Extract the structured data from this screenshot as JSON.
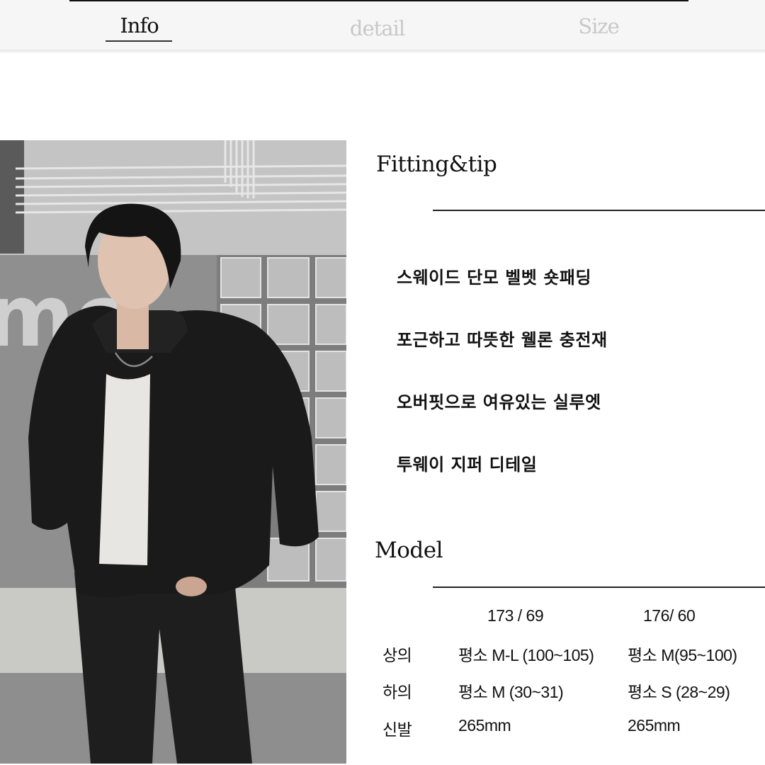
{
  "tabs": [
    {
      "label": "Info",
      "active": true
    },
    {
      "label": "detail",
      "active": false
    },
    {
      "label": "Size",
      "active": false
    }
  ],
  "photo": {
    "alt": "Model wearing black short puffer jacket, white tank top, black wide jeans, in front of glass-block wall"
  },
  "fitting": {
    "title": "Fitting&tip",
    "tips": [
      "스웨이드 단모 벨벳 숏패딩",
      "포근하고 따뜻한 웰론 충전재",
      "오버핏으로 여유있는 실루엣",
      "투웨이 지퍼 디테일"
    ]
  },
  "model": {
    "title": "Model",
    "models": [
      "173 / 69",
      "176/ 60"
    ],
    "rows": [
      {
        "label": "상의",
        "values": [
          "평소 M-L (100~105)",
          "평소 M(95~100)"
        ]
      },
      {
        "label": "하의",
        "values": [
          "평소 M (30~31)",
          "평소 S (28~29)"
        ]
      },
      {
        "label": "신발",
        "values": [
          "265mm",
          "265mm"
        ]
      }
    ]
  },
  "colors": {
    "tab_active": "#111111",
    "tab_inactive": "#c8c8c8",
    "tabbar_bg": "#f6f6f6",
    "rule": "#222222"
  }
}
